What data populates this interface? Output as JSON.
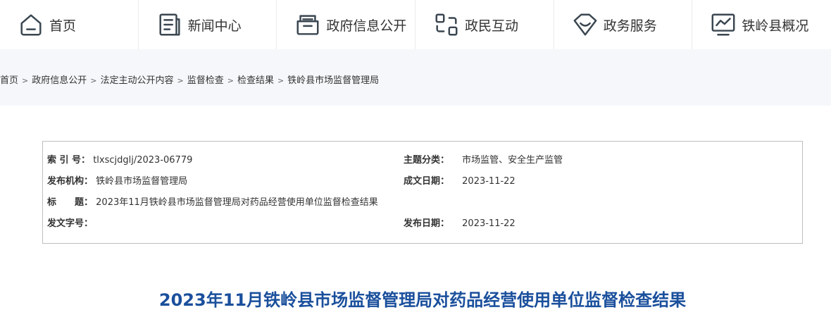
{
  "nav": {
    "items": [
      {
        "label": "首页",
        "icon": "home-icon"
      },
      {
        "label": "新闻中心",
        "icon": "news-icon"
      },
      {
        "label": "政府信息公开",
        "icon": "folder-icon"
      },
      {
        "label": "政民互动",
        "icon": "interaction-icon"
      },
      {
        "label": "政务服务",
        "icon": "service-icon"
      },
      {
        "label": "铁岭县概况",
        "icon": "overview-icon"
      }
    ]
  },
  "breadcrumb": {
    "items": [
      "首页",
      "政府信息公开",
      "法定主动公开内容",
      "监督检查",
      "检查结果",
      "铁岭县市场监督管理局"
    ],
    "separator": ">"
  },
  "meta": {
    "index_label": "索 引 号：",
    "index_value": "tlxscjdglj/2023-06779",
    "topic_label": "主题分类：",
    "topic_value": "市场监管、安全生产监管",
    "publisher_label": "发布机构：",
    "publisher_value": "铁岭县市场监督管理局",
    "created_label": "成文日期：",
    "created_value": "2023-11-22",
    "title_label": "标　　题：",
    "title_value": "2023年11月铁岭县市场监督管理局对药品经营使用单位监督检查结果",
    "docno_label": "发文字号：",
    "docno_value": "",
    "published_label": "发布日期：",
    "published_value": "2023-11-22"
  },
  "article": {
    "title": "2023年11月铁岭县市场监督管理局对药品经营使用单位监督检查结果"
  },
  "colors": {
    "title": "#1a4f9c",
    "crumb_bg": "#f5f7fa",
    "border": "#bfbfbf"
  }
}
